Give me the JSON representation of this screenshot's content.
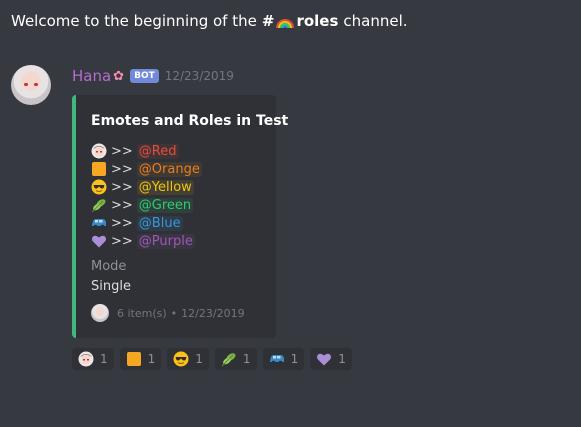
{
  "channel": {
    "welcome_text": "Welcome to the beginning of the",
    "hash": "#",
    "name": "roles",
    "suffix": "channel."
  },
  "message": {
    "username": "Hana",
    "bot_tag": "BOT",
    "timestamp": "12/23/2019"
  },
  "embed": {
    "accent_color": "#43b581",
    "title": "Emotes and Roles in Test",
    "roles": [
      {
        "emoji": "avatar-face-icon",
        "arrows": ">>",
        "role": "@Red",
        "color": "#e74c3c"
      },
      {
        "emoji": "orange-square-icon",
        "arrows": ">>",
        "role": "@Orange",
        "color": "#e67e22"
      },
      {
        "emoji": "sunglasses-face-icon",
        "arrows": ">>",
        "role": "@Yellow",
        "color": "#f1c40f"
      },
      {
        "emoji": "leaves-icon",
        "arrows": ">>",
        "role": "@Green",
        "color": "#2ecc71"
      },
      {
        "emoji": "car-icon",
        "arrows": ">>",
        "role": "@Blue",
        "color": "#3498db"
      },
      {
        "emoji": "purple-heart-icon",
        "arrows": ">>",
        "role": "@Purple",
        "color": "#9b59b6"
      }
    ],
    "field_name": "Mode",
    "field_value": "Single",
    "footer_text": "6 item(s)",
    "footer_timestamp": "12/23/2019"
  },
  "reactions": [
    {
      "emoji": "avatar-face-icon",
      "count": "1"
    },
    {
      "emoji": "orange-square-icon",
      "count": "1"
    },
    {
      "emoji": "sunglasses-face-icon",
      "count": "1"
    },
    {
      "emoji": "leaves-icon",
      "count": "1"
    },
    {
      "emoji": "car-icon",
      "count": "1"
    },
    {
      "emoji": "purple-heart-icon",
      "count": "1"
    }
  ]
}
